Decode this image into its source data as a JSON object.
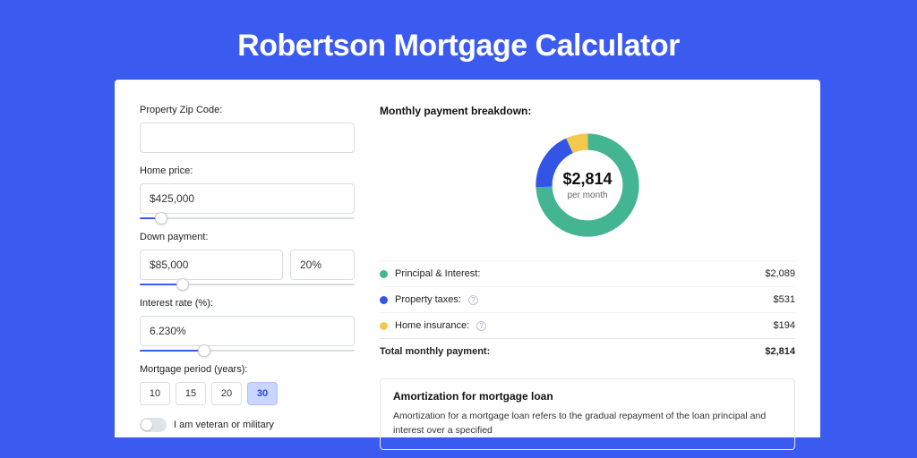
{
  "title": "Robertson Mortgage Calculator",
  "form": {
    "zip_label": "Property Zip Code:",
    "zip_value": "",
    "home_price_label": "Home price:",
    "home_price_value": "$425,000",
    "home_price_slider_pct": 10,
    "down_payment_label": "Down payment:",
    "down_payment_value": "$85,000",
    "down_payment_pct_value": "20%",
    "down_payment_slider_pct": 20,
    "interest_label": "Interest rate (%):",
    "interest_value": "6.230%",
    "interest_slider_pct": 30,
    "period_label": "Mortgage period (years):",
    "periods": [
      "10",
      "15",
      "20",
      "30"
    ],
    "period_active_index": 3,
    "veteran_label": "I am veteran or military"
  },
  "breakdown": {
    "heading": "Monthly payment breakdown:",
    "donut_amount": "$2,814",
    "donut_sub": "per month",
    "rows": [
      {
        "label": "Principal & Interest:",
        "value": "$2,089",
        "color": "#44b592",
        "info": false
      },
      {
        "label": "Property taxes:",
        "value": "$531",
        "color": "#3355e6",
        "info": true
      },
      {
        "label": "Home insurance:",
        "value": "$194",
        "color": "#f2c94c",
        "info": true
      }
    ],
    "total_label": "Total monthly payment:",
    "total_value": "$2,814"
  },
  "amort": {
    "title": "Amortization for mortgage loan",
    "text": "Amortization for a mortgage loan refers to the gradual repayment of the loan principal and interest over a specified"
  },
  "chart_data": {
    "type": "pie",
    "title": "Monthly payment breakdown",
    "total": 2814,
    "series": [
      {
        "name": "Principal & Interest",
        "value": 2089,
        "color": "#44b592"
      },
      {
        "name": "Property taxes",
        "value": 531,
        "color": "#3355e6"
      },
      {
        "name": "Home insurance",
        "value": 194,
        "color": "#f2c94c"
      }
    ]
  }
}
